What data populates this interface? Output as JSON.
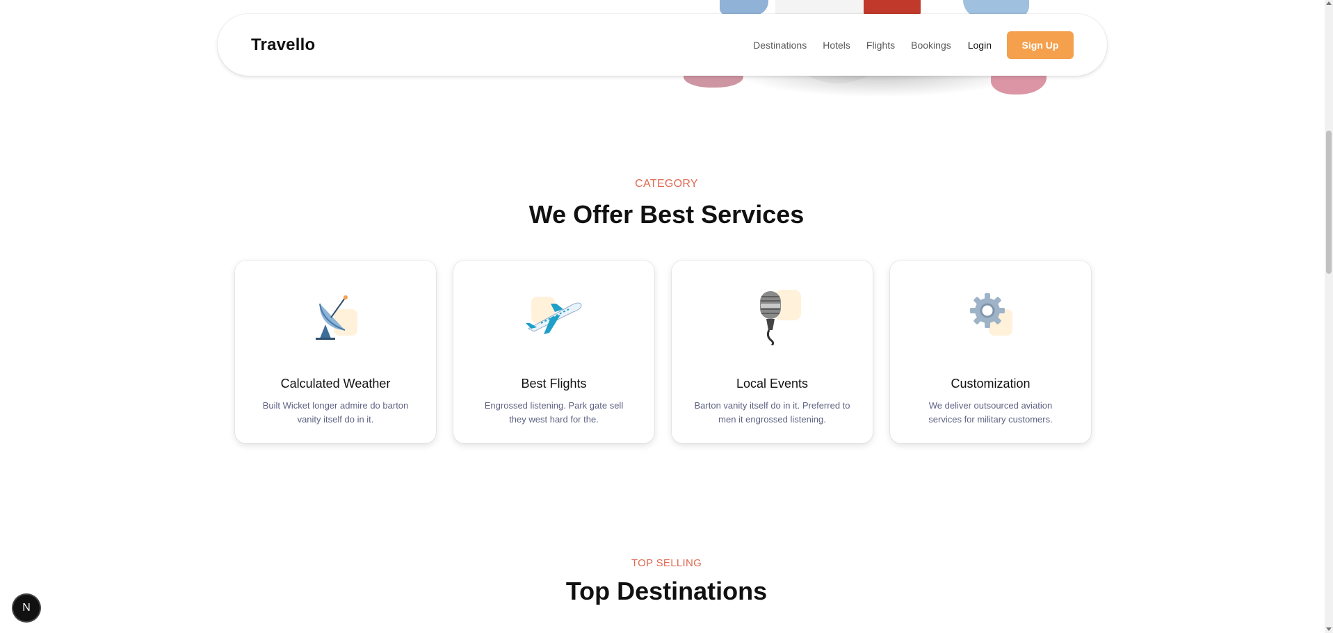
{
  "nav": {
    "brand": "Travello",
    "links": [
      "Destinations",
      "Hotels",
      "Flights",
      "Bookings"
    ],
    "login": "Login",
    "signup": "Sign Up"
  },
  "services": {
    "label": "CATEGORY",
    "title": "We Offer Best Services",
    "cards": [
      {
        "icon": "satellite-dish-icon",
        "title": "Calculated Weather",
        "text": "Built Wicket longer admire do barton vanity itself do in it."
      },
      {
        "icon": "airplane-icon",
        "title": "Best Flights",
        "text": "Engrossed listening. Park gate sell they west hard for the."
      },
      {
        "icon": "microphone-icon",
        "title": "Local Events",
        "text": "Barton vanity itself do in it. Preferred to men it engrossed listening."
      },
      {
        "icon": "gear-icon",
        "title": "Customization",
        "text": "We deliver outsourced aviation services for military customers."
      }
    ]
  },
  "destinations": {
    "label": "TOP SELLING",
    "title": "Top Destinations"
  },
  "badge": {
    "letter": "N"
  },
  "colors": {
    "accent": "#f4a04c",
    "label": "#df6951",
    "icon_bg": "#fff1da"
  }
}
